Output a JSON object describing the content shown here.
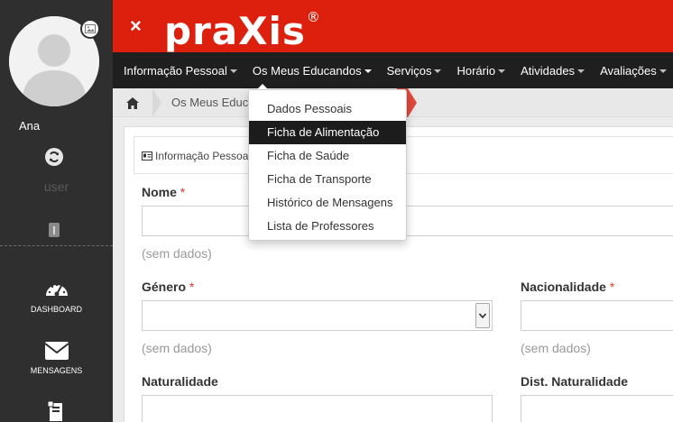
{
  "sidebar": {
    "username": "Ana",
    "role": "user",
    "items": [
      {
        "label": "DASHBOARD",
        "icon": "dashboard-gauge-icon"
      },
      {
        "label": "MENSAGENS",
        "icon": "envelope-icon"
      },
      {
        "label": "",
        "icon": "documents-icon"
      }
    ]
  },
  "topbar": {
    "close_label": "×",
    "logo_text": "praXis",
    "logo_mark": "®"
  },
  "nav": {
    "items": [
      {
        "label": "Informação Pessoal"
      },
      {
        "label": "Os Meus Educandos"
      },
      {
        "label": "Serviços"
      },
      {
        "label": "Horário"
      },
      {
        "label": "Atividades"
      },
      {
        "label": "Avaliações"
      }
    ]
  },
  "breadcrumb": {
    "current": "Os Meus Educandos"
  },
  "dropdown": {
    "items": [
      {
        "label": "Dados Pessoais"
      },
      {
        "label": "Ficha de Alimentação"
      },
      {
        "label": "Ficha de Saúde"
      },
      {
        "label": "Ficha de Transporte"
      },
      {
        "label": "Histórico de Mensagens"
      },
      {
        "label": "Lista de Professores"
      }
    ]
  },
  "panel": {
    "title": "Informação Pessoal"
  },
  "form": {
    "nome_label": "Nome",
    "genero_label": "Género",
    "nacionalidade_label": "Nacionalidade",
    "naturalidade_label": "Naturalidade",
    "dist_naturalidade_label": "Dist. Naturalidade",
    "required_mark": "*",
    "empty_hint": "(sem dados)"
  },
  "colors": {
    "brand_red": "#dd1f0e",
    "nav_bg": "#1f1f1f",
    "sidebar_bg": "#2f2f2f"
  }
}
